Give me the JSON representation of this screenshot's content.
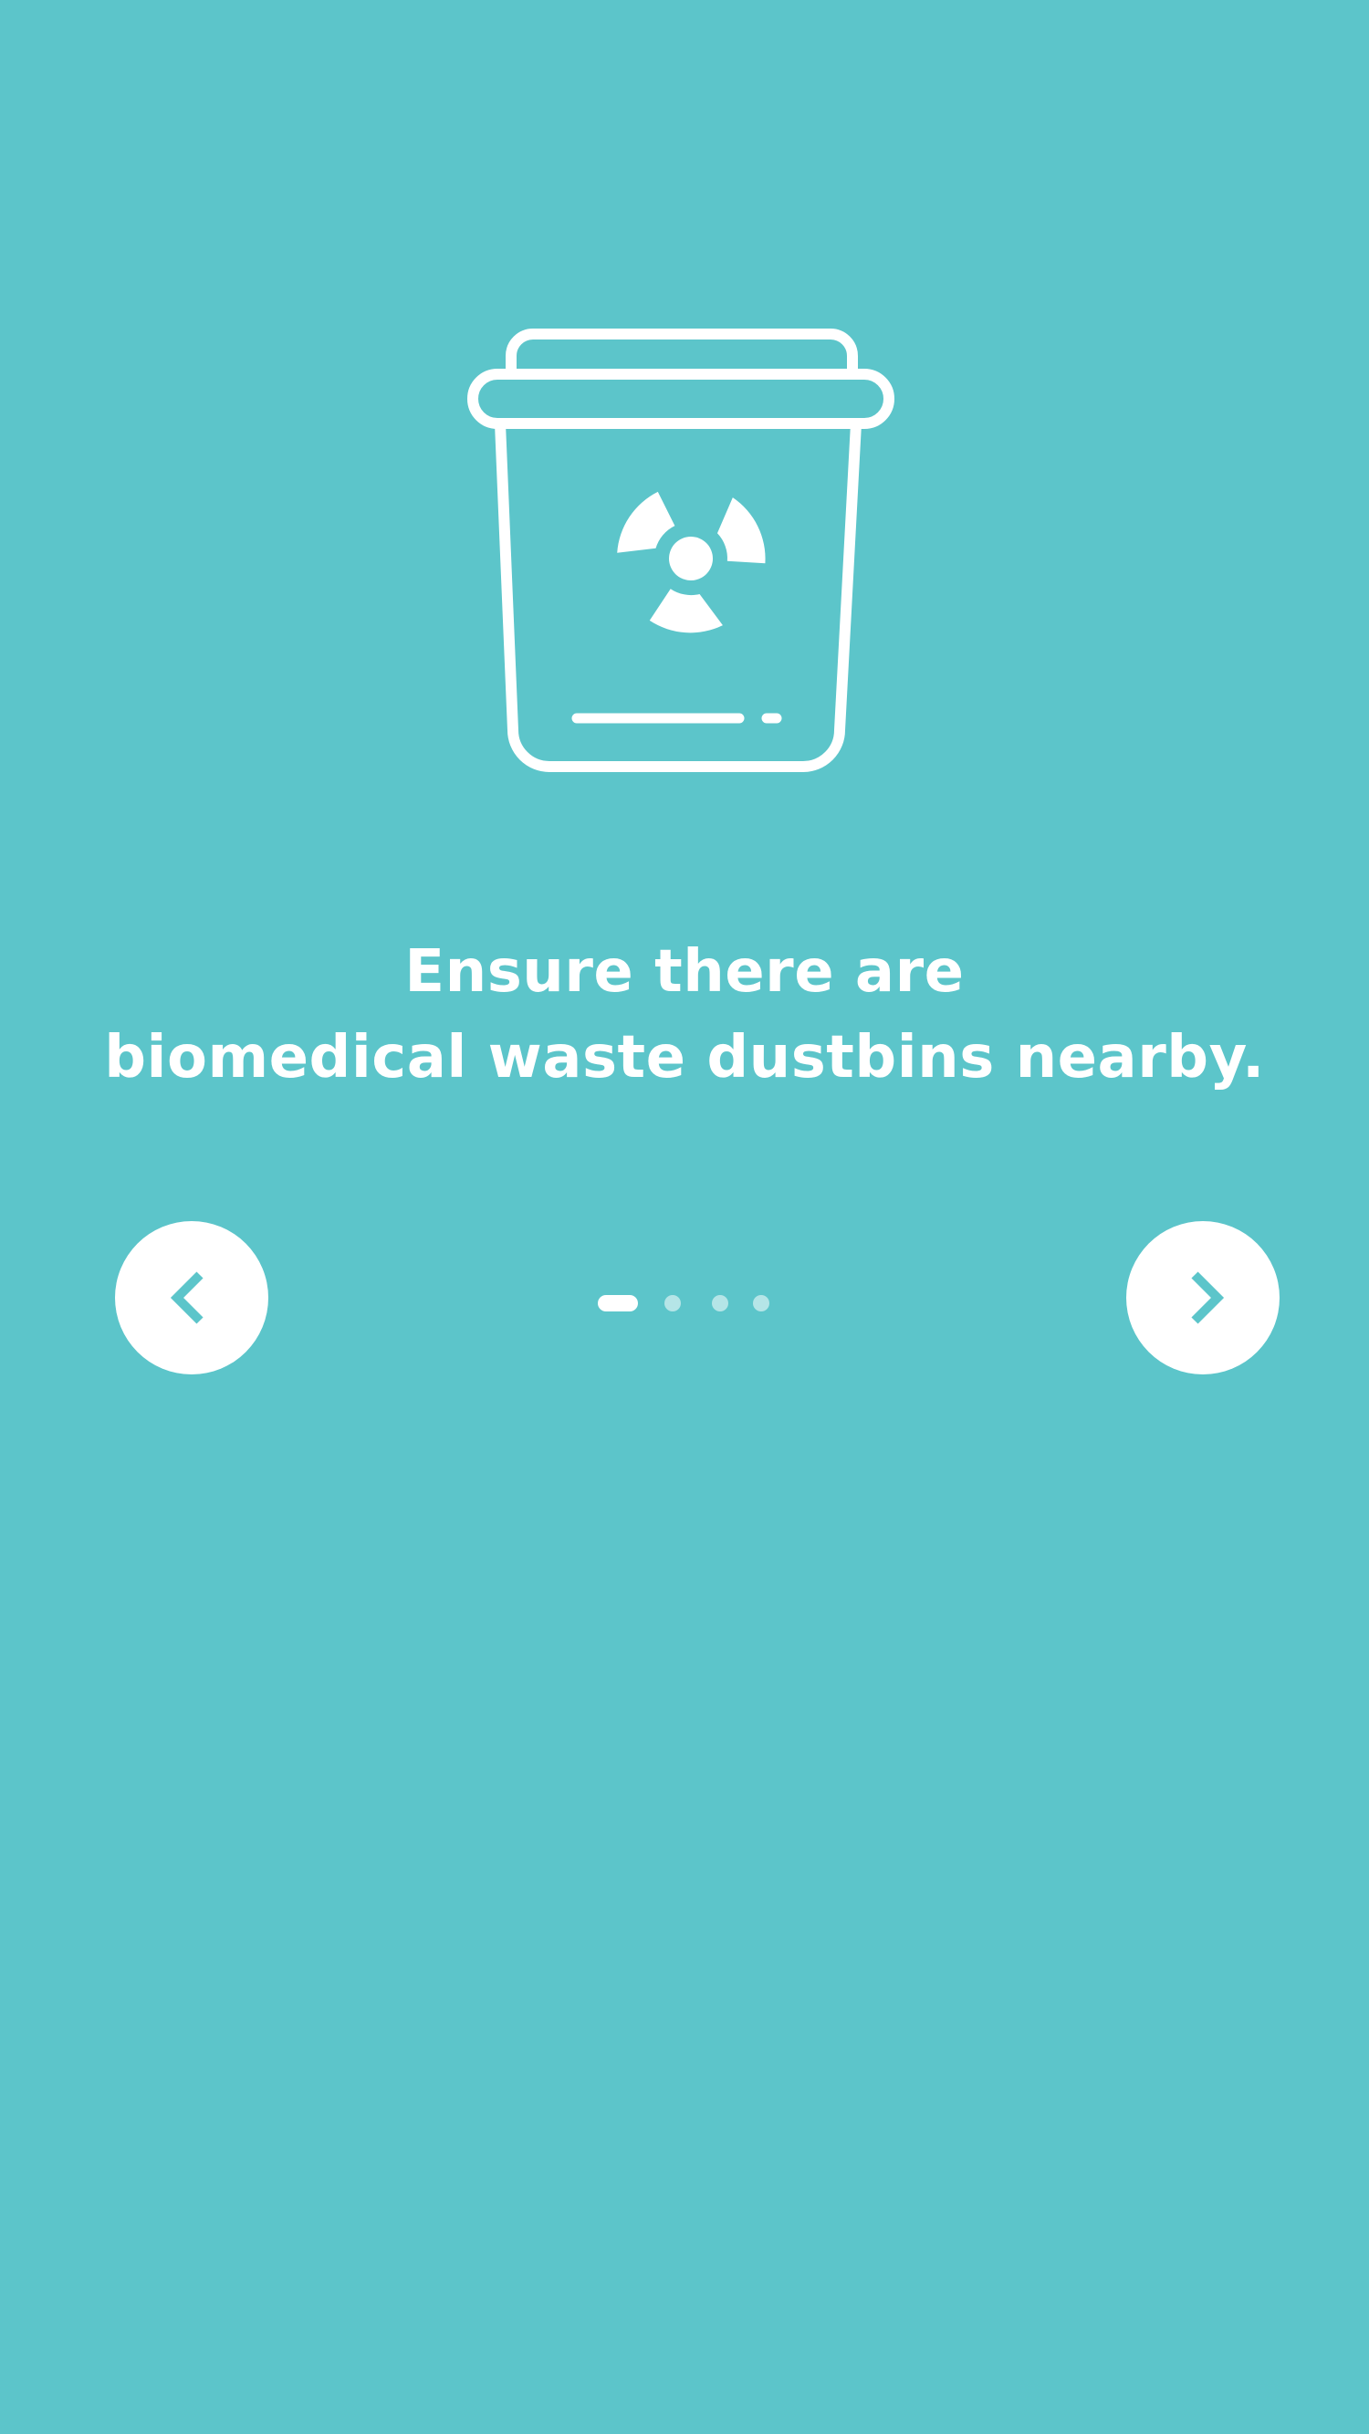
{
  "onboarding": {
    "illustration": "biohazard-dustbin-icon",
    "headline_line1": "Ensure there are",
    "headline_line2": "biomedical waste dustbins nearby.",
    "prev_icon": "chevron-left-icon",
    "next_icon": "chevron-right-icon",
    "pager": {
      "total": 4,
      "current": 1
    }
  },
  "colors": {
    "background": "#5cc5ca",
    "foreground": "#ffffff"
  }
}
